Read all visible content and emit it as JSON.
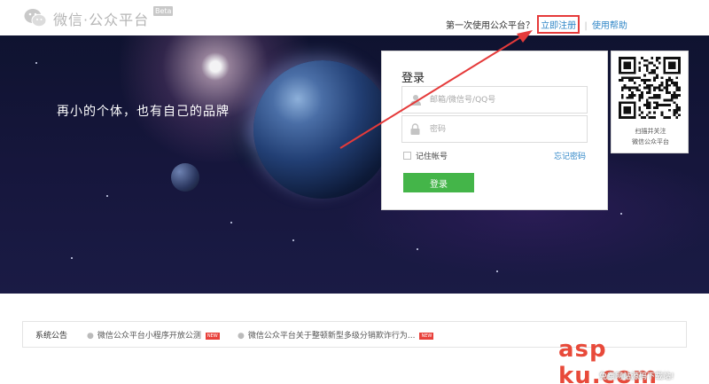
{
  "header": {
    "logo_text": "微信·公众平台",
    "beta": "Beta",
    "first_time": "第一次使用公众平台？",
    "register": "立即注册",
    "separator": "|",
    "help": "使用帮助"
  },
  "banner": {
    "slogan": "再小的个体，也有自己的品牌"
  },
  "login": {
    "title": "登录",
    "username_placeholder": "邮箱/微信号/QQ号",
    "password_placeholder": "密码",
    "remember_label": "记住帐号",
    "forgot_label": "忘记密码",
    "submit_label": "登录"
  },
  "qr": {
    "caption_line1": "扫描并关注",
    "caption_line2": "微信公众平台"
  },
  "notices": {
    "title": "系统公告",
    "items": [
      {
        "text": "微信公众平台小程序开放公测",
        "badge": "NEW"
      },
      {
        "text": "微信公众平台关于整顿新型多级分销欺诈行为...",
        "badge": "NEW"
      }
    ]
  },
  "watermark": {
    "logo": "asp ku.com",
    "sub": "免费网站源码下载站!"
  },
  "colors": {
    "accent_green": "#44b549",
    "link_blue": "#2f86c7",
    "annotation_red": "#e53a3a"
  }
}
